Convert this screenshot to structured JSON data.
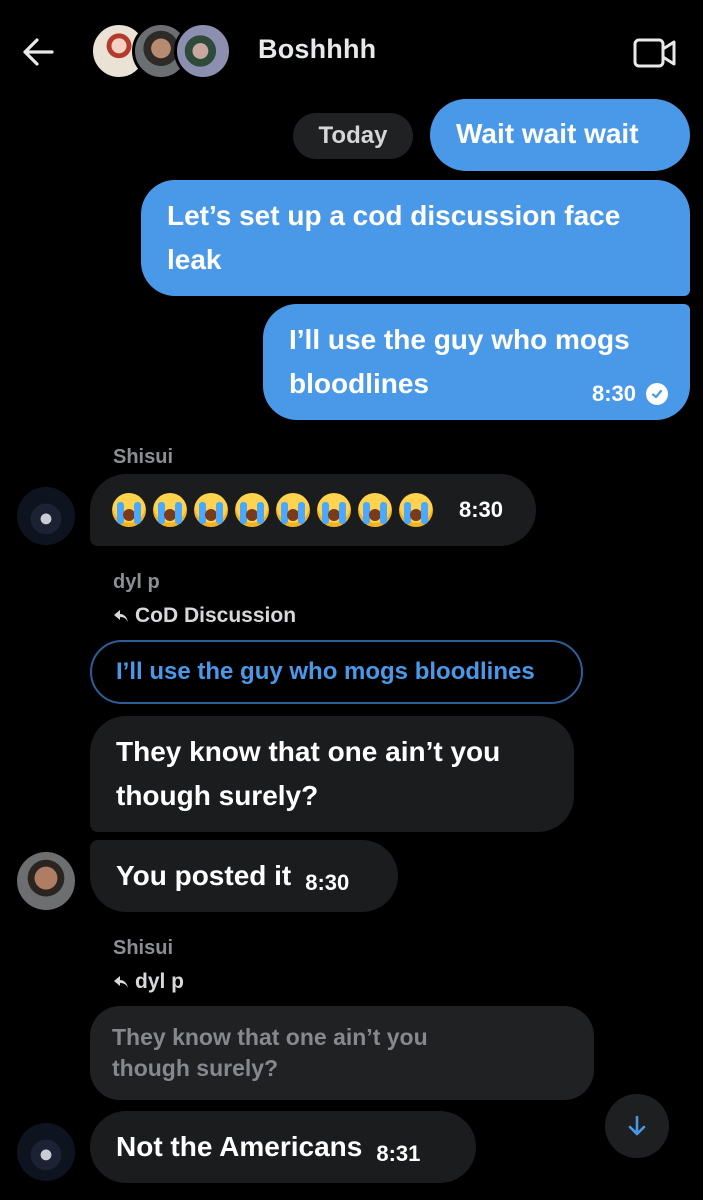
{
  "header": {
    "title": "Boshhhh",
    "back_icon": "arrow-left-icon",
    "video_icon": "video-camera-icon"
  },
  "date_chip": "Today",
  "colors": {
    "outgoing_bubble": "#4a99e9",
    "incoming_bubble": "#1b1c1e",
    "background": "#000000",
    "link_blue": "#4a99e9"
  },
  "messages": [
    {
      "direction": "out",
      "text": "Wait wait wait"
    },
    {
      "direction": "out",
      "text": "Let’s set up a cod discussion face leak"
    },
    {
      "direction": "out",
      "text": "I’ll use the guy who mogs bloodlines",
      "time": "8:30",
      "status_icon": "read-check-icon"
    },
    {
      "direction": "in",
      "sender": "Shisui",
      "text": "😭😭😭😭😭😭😭😭",
      "time": "8:30"
    },
    {
      "direction": "in",
      "sender": "dyl p",
      "reply_to": "CoD Discussion",
      "quoted": "I’ll use the guy who mogs bloodlines",
      "text": "They know that one ain’t you though surely?"
    },
    {
      "direction": "in",
      "text": "You posted it",
      "time": "8:30"
    },
    {
      "direction": "in",
      "sender": "Shisui",
      "reply_to": "dyl p",
      "quoted": "They know that one ain’t you though surely?",
      "text": "Not the Americans",
      "time": "8:31"
    }
  ],
  "scroll_button_icon": "arrow-down-icon"
}
